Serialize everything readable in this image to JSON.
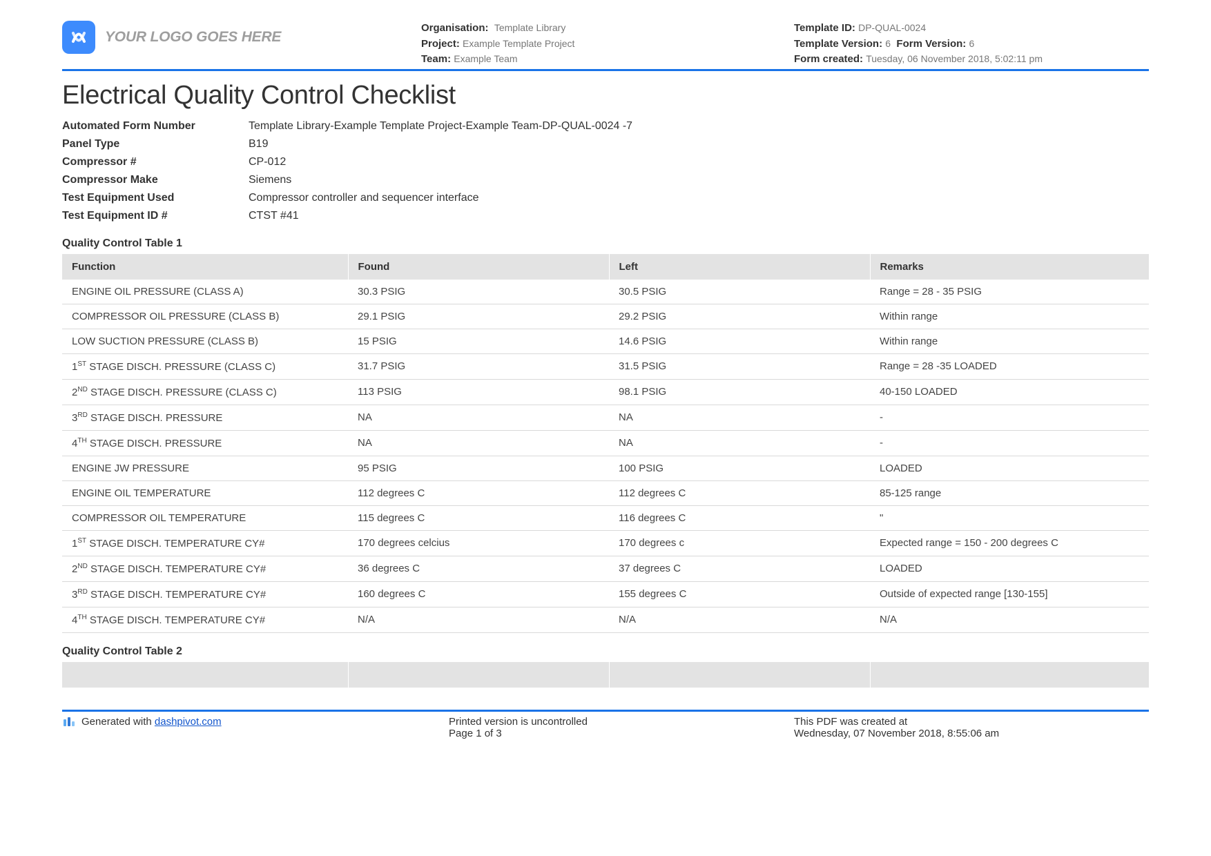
{
  "header": {
    "logo_text": "YOUR LOGO GOES HERE",
    "org_label": "Organisation:",
    "org_value": "Template Library",
    "project_label": "Project:",
    "project_value": "Example Template Project",
    "team_label": "Team:",
    "team_value": "Example Team",
    "template_id_label": "Template ID:",
    "template_id_value": "DP-QUAL-0024",
    "template_version_label": "Template Version:",
    "template_version_value": "6",
    "form_version_label": "Form Version:",
    "form_version_value": "6",
    "form_created_label": "Form created:",
    "form_created_value": "Tuesday, 06 November 2018, 5:02:11 pm"
  },
  "title": "Electrical Quality Control Checklist",
  "info": [
    {
      "label": "Automated Form Number",
      "value": "Template Library-Example Template Project-Example Team-DP-QUAL-0024   -7"
    },
    {
      "label": "Panel Type",
      "value": "B19"
    },
    {
      "label": "Compressor #",
      "value": "CP-012"
    },
    {
      "label": "Compressor Make",
      "value": "Siemens"
    },
    {
      "label": "Test Equipment Used",
      "value": "Compressor controller and sequencer interface"
    },
    {
      "label": "Test Equipment ID #",
      "value": "CTST #41"
    }
  ],
  "table1": {
    "title": "Quality Control Table 1",
    "columns": [
      "Function",
      "Found",
      "Left",
      "Remarks"
    ],
    "rows": [
      {
        "func": "ENGINE OIL PRESSURE (CLASS A)",
        "found": "30.3 PSIG",
        "left": "30.5 PSIG",
        "remarks": "Range = 28 - 35 PSIG"
      },
      {
        "func": "COMPRESSOR OIL PRESSURE (CLASS B)",
        "found": "29.1 PSIG",
        "left": "29.2 PSIG",
        "remarks": "Within range"
      },
      {
        "func": "LOW SUCTION PRESSURE (CLASS B)",
        "found": "15 PSIG",
        "left": "14.6 PSIG",
        "remarks": "Within range"
      },
      {
        "func_html": "1<sup>ST</sup> STAGE DISCH. PRESSURE (CLASS C)",
        "found": "31.7 PSIG",
        "left": "31.5 PSIG",
        "remarks": "Range = 28 -35 LOADED"
      },
      {
        "func_html": "2<sup>ND</sup> STAGE DISCH. PRESSURE (CLASS C)",
        "found": "113 PSIG",
        "left": "98.1 PSIG",
        "remarks": "40-150 LOADED"
      },
      {
        "func_html": "3<sup>RD</sup> STAGE DISCH. PRESSURE",
        "found": "NA",
        "left": "NA",
        "remarks": "-"
      },
      {
        "func_html": "4<sup>TH</sup> STAGE DISCH. PRESSURE",
        "found": "NA",
        "left": "NA",
        "remarks": "-"
      },
      {
        "func": "ENGINE JW PRESSURE",
        "found": "95 PSIG",
        "left": "100 PSIG",
        "remarks": "LOADED"
      },
      {
        "func": "ENGINE OIL TEMPERATURE",
        "found": "112 degrees C",
        "left": "112 degrees C",
        "remarks": "85-125 range"
      },
      {
        "func": "COMPRESSOR OIL TEMPERATURE",
        "found": "115 degrees C",
        "left": "116 degrees C",
        "remarks": "\""
      },
      {
        "func_html": "1<sup>ST</sup> STAGE DISCH. TEMPERATURE CY#",
        "found": "170 degrees celcius",
        "left": "170 degrees c",
        "remarks": "Expected range = 150 - 200 degrees C"
      },
      {
        "func_html": "2<sup>ND</sup> STAGE DISCH. TEMPERATURE CY#",
        "found": "36 degrees C",
        "left": "37 degrees C",
        "remarks": "LOADED"
      },
      {
        "func_html": "3<sup>RD</sup> STAGE DISCH. TEMPERATURE CY#",
        "found": "160 degrees C",
        "left": "155 degrees C",
        "remarks": "Outside of expected range [130-155]"
      },
      {
        "func_html": "4<sup>TH</sup> STAGE DISCH. TEMPERATURE CY#",
        "found": "N/A",
        "left": "N/A",
        "remarks": "N/A"
      }
    ]
  },
  "table2": {
    "title": "Quality Control Table 2"
  },
  "footer": {
    "generated_prefix": "Generated with ",
    "generated_link": "dashpivot.com",
    "uncontrolled": "Printed version is uncontrolled",
    "page": "Page 1 of 3",
    "created_label": "This PDF was created at",
    "created_value": "Wednesday, 07 November 2018, 8:55:06 am"
  }
}
